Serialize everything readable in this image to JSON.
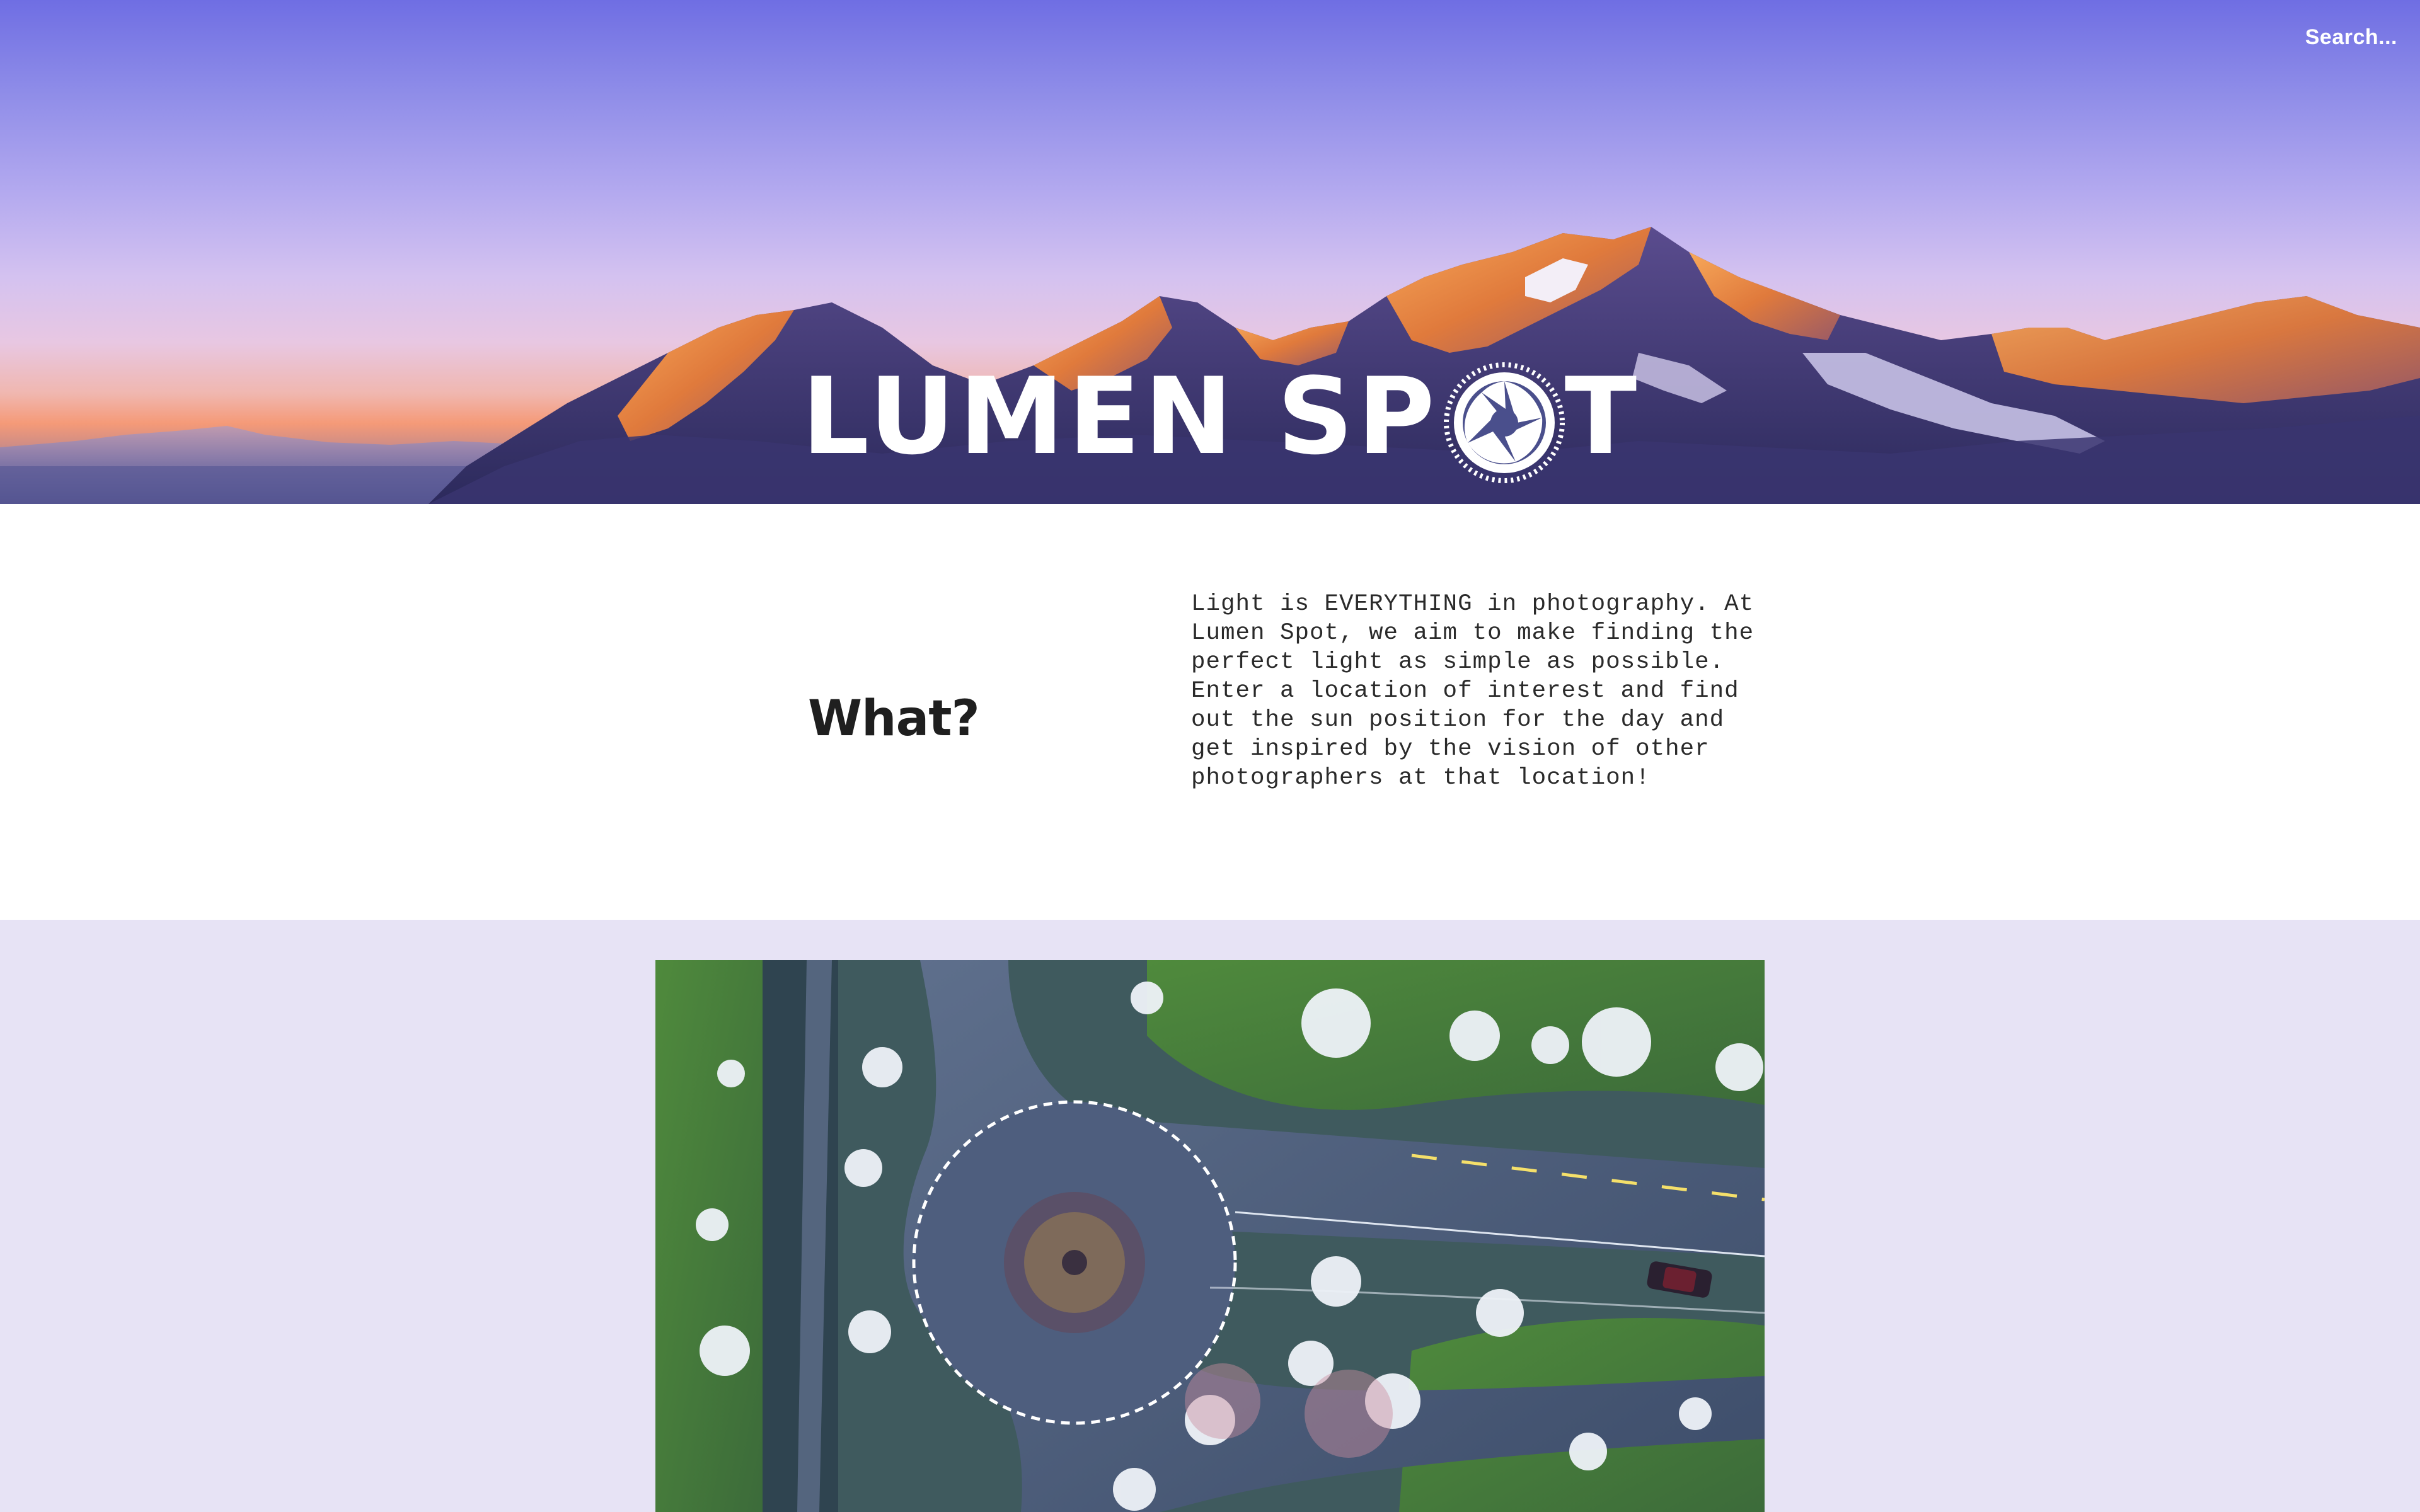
{
  "header": {
    "search_label": "Search...",
    "logo_text_left": "LUMEN SP",
    "logo_text_right": "T",
    "logo_icon": "camera-aperture-icon"
  },
  "what": {
    "heading": "What?",
    "text": "Light is EVERYTHING in photography. At Lumen Spot, we aim to make finding the perfect light as simple as possible. Enter a location of interest and find out the sun position for the day and get inspired by the vision of other photographers at that location!"
  },
  "gallery": {
    "featured_image": "aerial-roundabout-photo"
  },
  "colors": {
    "hero_sky": "#8e8ce8",
    "gallery_bg": "#e7e3f5",
    "heading": "#1f1f1f",
    "body_text": "#2a2a2a"
  }
}
